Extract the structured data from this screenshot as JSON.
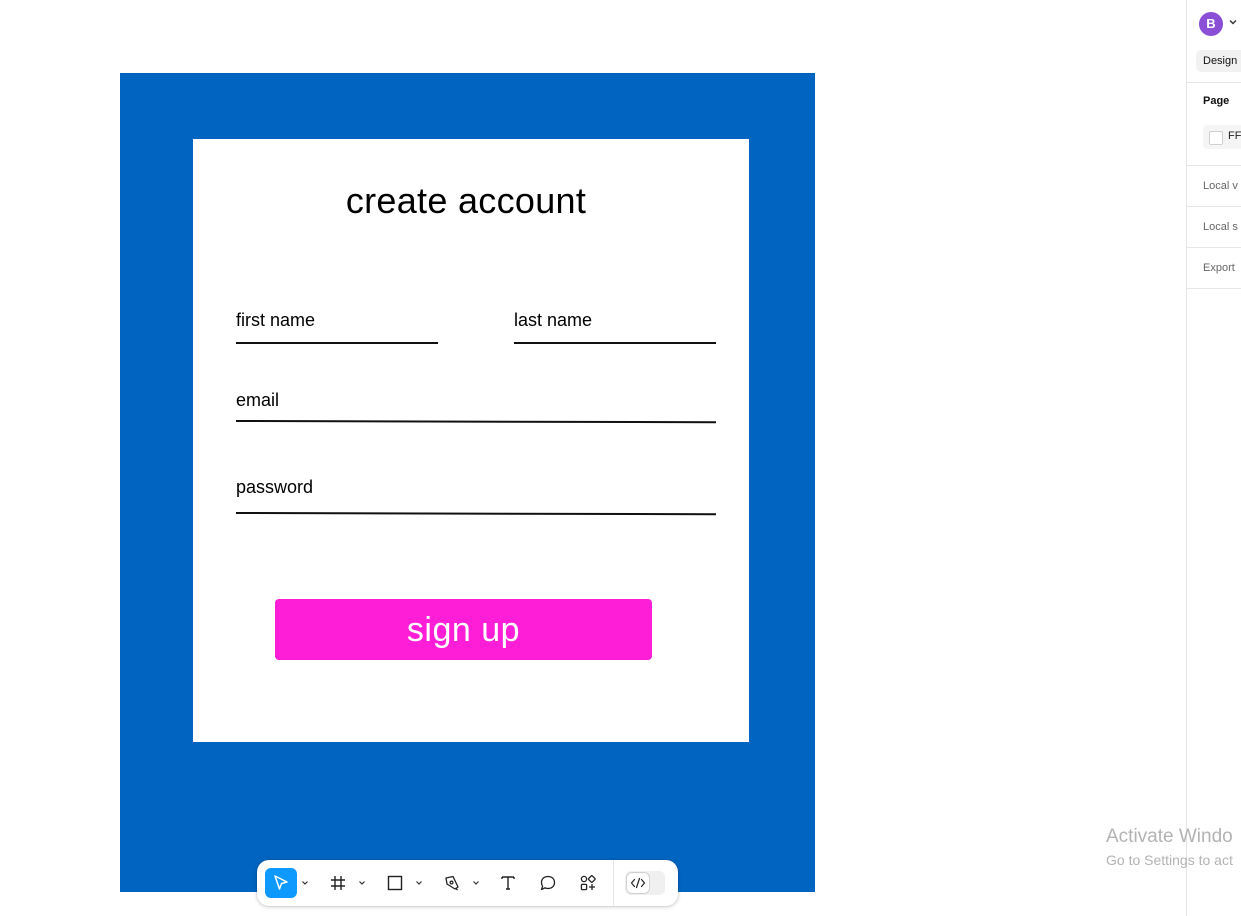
{
  "form": {
    "title": "create account",
    "fields": {
      "first_name": "first name",
      "last_name": "last name",
      "email": "email",
      "password": "password"
    },
    "button_label": "sign up",
    "colors": {
      "frame": "#0064c0",
      "card": "#ffffff",
      "button": "#ff1ed7",
      "button_text": "#ffffff"
    }
  },
  "right_panel": {
    "avatar_initial": "B",
    "avatar_color": "#8a4fd6",
    "tabs": {
      "design": "Design"
    },
    "page_section": {
      "heading": "Page",
      "color_value": "FF"
    },
    "sections": {
      "local_variables": "Local v",
      "local_styles": "Local s",
      "export": "Export"
    }
  },
  "toolbar": {
    "tools": [
      {
        "name": "move",
        "icon": "cursor-icon",
        "active": true
      },
      {
        "name": "frame",
        "icon": "frame-icon"
      },
      {
        "name": "shape",
        "icon": "rectangle-icon"
      },
      {
        "name": "pen",
        "icon": "pen-icon"
      },
      {
        "name": "text",
        "icon": "text-icon"
      },
      {
        "name": "comment",
        "icon": "comment-icon"
      },
      {
        "name": "resources",
        "icon": "resources-icon"
      },
      {
        "name": "dev-mode",
        "icon": "code-icon"
      }
    ],
    "accent_color": "#0d99ff"
  },
  "watermark": {
    "title": "Activate Windo",
    "subtitle": "Go to Settings to act"
  }
}
